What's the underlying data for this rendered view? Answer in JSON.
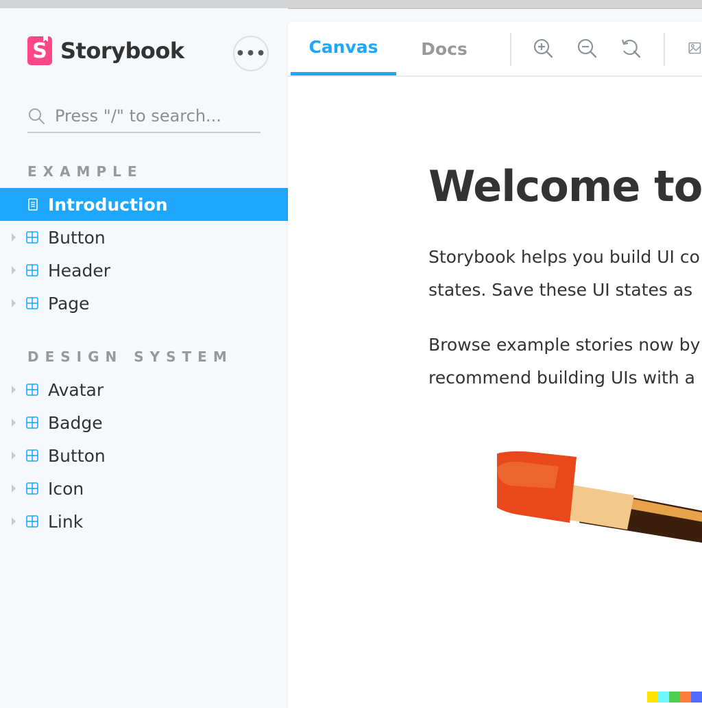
{
  "app": {
    "name": "Storybook",
    "logo_letter": "S",
    "brand_color": "#ff4785",
    "accent_color": "#1ea7fd"
  },
  "sidebar": {
    "more_button_label": "•••",
    "search": {
      "placeholder": "Press \"/\" to search...",
      "value": ""
    },
    "sections": [
      {
        "title": "EXAMPLE",
        "items": [
          {
            "label": "Introduction",
            "icon": "document-icon",
            "active": true
          },
          {
            "label": "Button",
            "icon": "component-icon",
            "active": false
          },
          {
            "label": "Header",
            "icon": "component-icon",
            "active": false
          },
          {
            "label": "Page",
            "icon": "component-icon",
            "active": false
          }
        ]
      },
      {
        "title": "DESIGN SYSTEM",
        "items": [
          {
            "label": "Avatar",
            "icon": "component-icon",
            "active": false
          },
          {
            "label": "Badge",
            "icon": "component-icon",
            "active": false
          },
          {
            "label": "Button",
            "icon": "component-icon",
            "active": false
          },
          {
            "label": "Icon",
            "icon": "component-icon",
            "active": false
          },
          {
            "label": "Link",
            "icon": "component-icon",
            "active": false
          }
        ]
      }
    ]
  },
  "toolbar": {
    "tabs": [
      {
        "label": "Canvas",
        "active": true
      },
      {
        "label": "Docs",
        "active": false
      }
    ],
    "tools": [
      "zoom-in-icon",
      "zoom-out-icon",
      "zoom-reset-icon",
      "background-image-icon"
    ]
  },
  "content": {
    "heading": "Welcome to S",
    "paragraphs": [
      "Storybook helps you build UI co",
      "states. Save these UI states as",
      "Browse example stories now by",
      "recommend building UIs with a"
    ]
  },
  "swatch_colors": [
    "#ffe400",
    "#6ff5ff",
    "#50cf50",
    "#ff7e3f",
    "#4f6bff"
  ]
}
